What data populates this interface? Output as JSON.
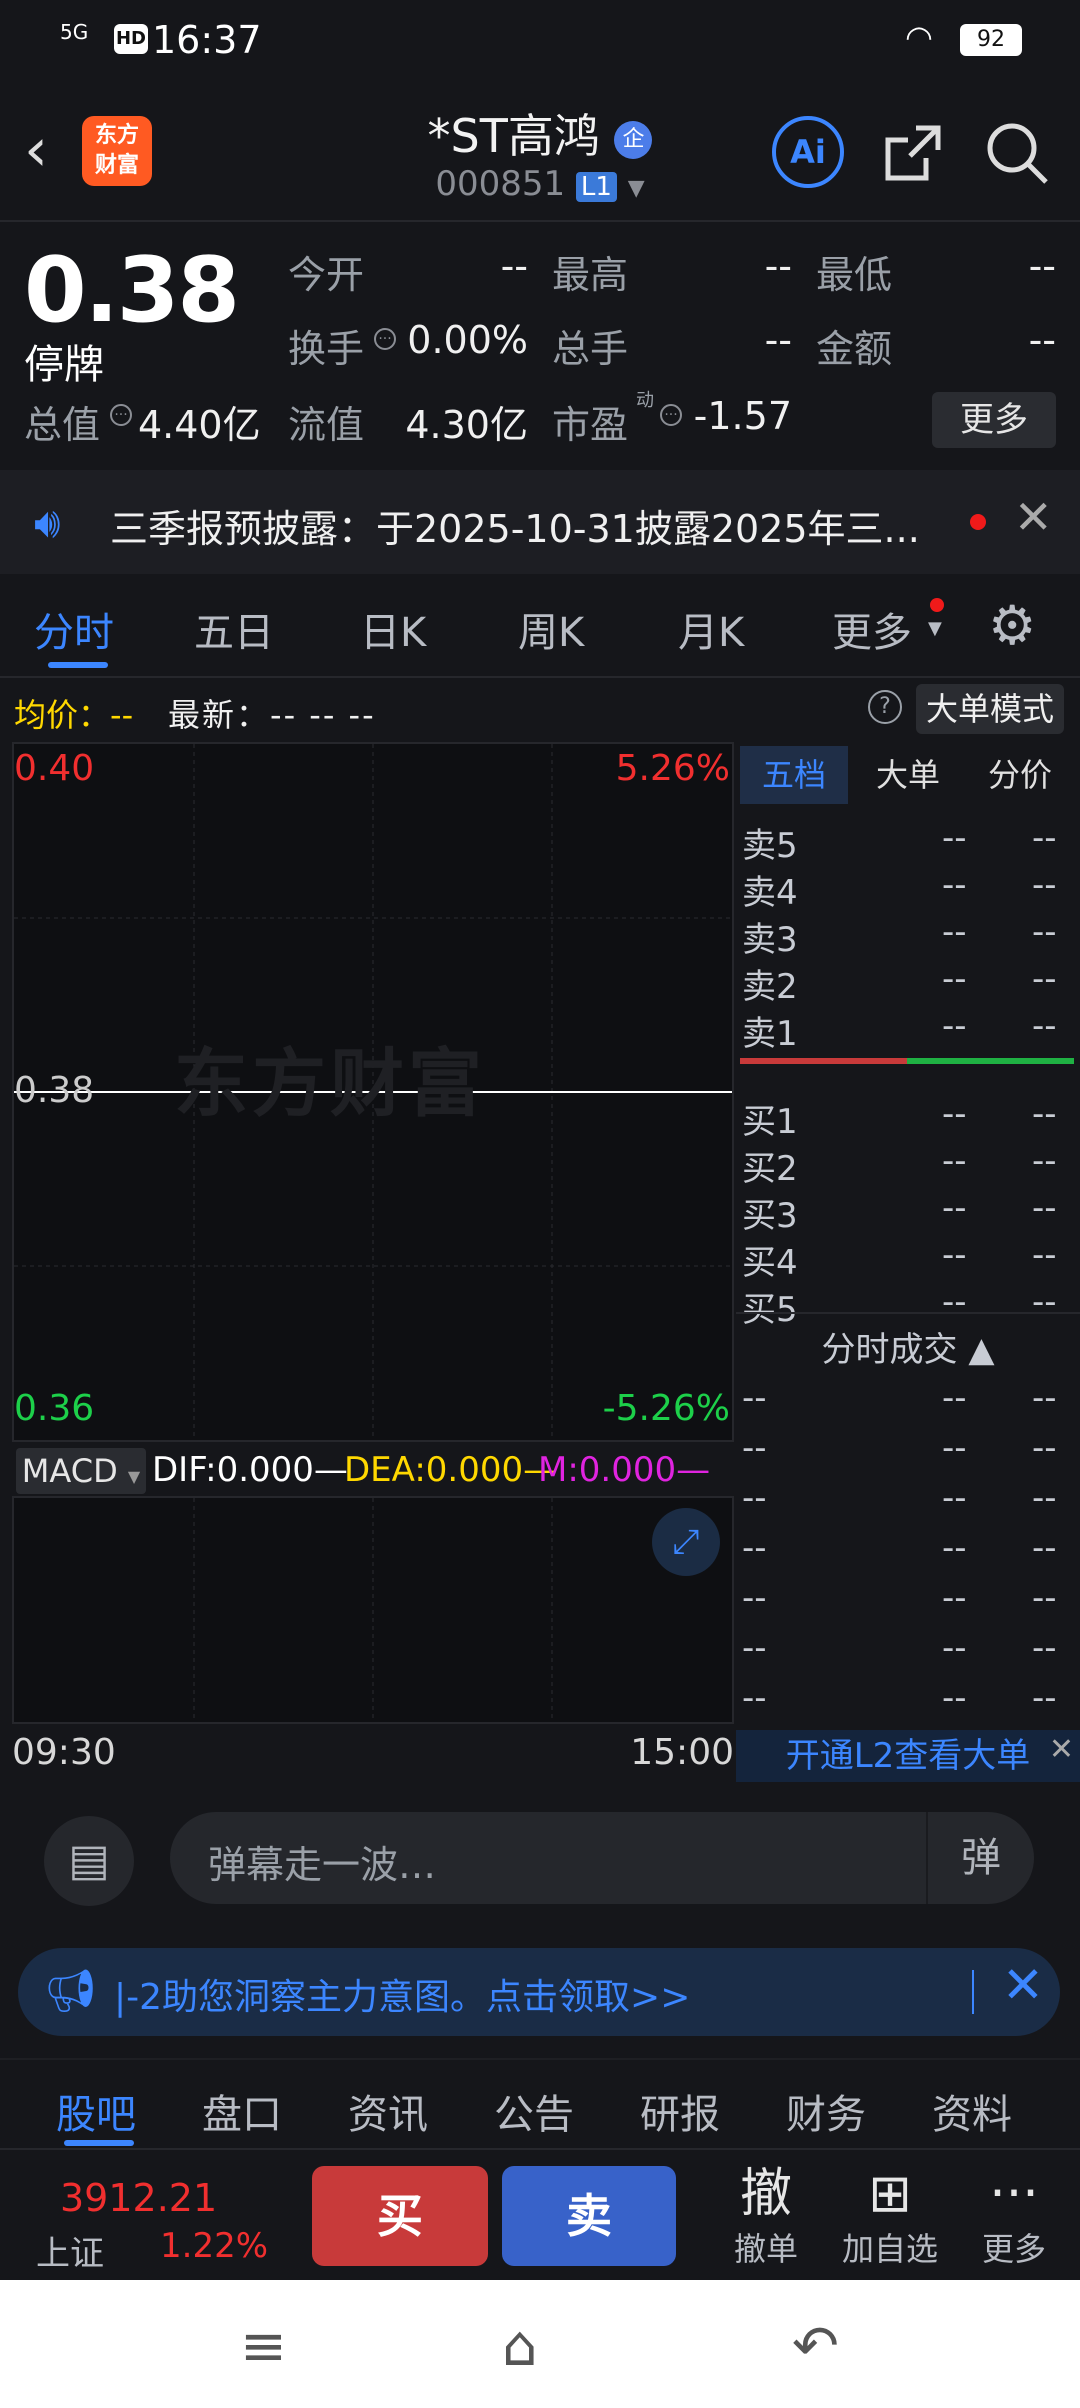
{
  "status": {
    "time": "16:37",
    "network": "5G",
    "hd": "HD",
    "battery": "92"
  },
  "header": {
    "back": "‹",
    "logo_text": "东方\n财富",
    "title": "*ST高鸿",
    "title_badge": "企",
    "code": "000851",
    "level": "L1",
    "ai_label": "Ai"
  },
  "quote": {
    "price": "0.38",
    "status": "停牌",
    "fields": {
      "open_label": "今开",
      "open_val": "--",
      "high_label": "最高",
      "high_val": "--",
      "low_label": "最低",
      "low_val": "--",
      "turnover_label": "换手",
      "turnover_val": "0.00%",
      "volume_label": "总手",
      "volume_val": "--",
      "amount_label": "金额",
      "amount_val": "--",
      "mktcap_label": "总值",
      "mktcap_val": "4.40亿",
      "float_label": "流值",
      "float_val": "4.30亿",
      "pe_label": "市盈",
      "pe_sup": "动",
      "pe_val": "-1.57"
    },
    "more_button": "更多"
  },
  "notice": {
    "text": "三季报预披露：于2025-10-31披露2025年三..."
  },
  "chart_tabs": [
    "分时",
    "五日",
    "日K",
    "周K",
    "月K",
    "更多"
  ],
  "info_row": {
    "avg_label": "均价：",
    "avg_val": "--",
    "latest_label": "最新：",
    "latest_val": "--  --  --",
    "mode_button": "大单模式"
  },
  "chart": {
    "watermark": "东方财富",
    "y_top": "0.40",
    "y_top_pct": "5.26%",
    "y_mid": "0.38",
    "y_bot": "0.36",
    "y_bot_pct": "-5.26%",
    "time_start": "09:30",
    "time_end": "15:00"
  },
  "macd": {
    "select": "MACD",
    "dif": "DIF:0.000—",
    "dea": "DEA:0.000—",
    "m": "M:0.000—"
  },
  "book": {
    "tabs": [
      "五档",
      "大单",
      "分价"
    ],
    "asks": [
      {
        "label": "卖5",
        "price": "--",
        "vol": "--"
      },
      {
        "label": "卖4",
        "price": "--",
        "vol": "--"
      },
      {
        "label": "卖3",
        "price": "--",
        "vol": "--"
      },
      {
        "label": "卖2",
        "price": "--",
        "vol": "--"
      },
      {
        "label": "卖1",
        "price": "--",
        "vol": "--"
      }
    ],
    "bids": [
      {
        "label": "买1",
        "price": "--",
        "vol": "--"
      },
      {
        "label": "买2",
        "price": "--",
        "vol": "--"
      },
      {
        "label": "买3",
        "price": "--",
        "vol": "--"
      },
      {
        "label": "买4",
        "price": "--",
        "vol": "--"
      },
      {
        "label": "买5",
        "price": "--",
        "vol": "--"
      }
    ],
    "ticks_header": "分时成交 ▲",
    "ticks": [
      {
        "t": "--",
        "p": "--",
        "v": "--"
      },
      {
        "t": "--",
        "p": "--",
        "v": "--"
      },
      {
        "t": "--",
        "p": "--",
        "v": "--"
      },
      {
        "t": "--",
        "p": "--",
        "v": "--"
      },
      {
        "t": "--",
        "p": "--",
        "v": "--"
      },
      {
        "t": "--",
        "p": "--",
        "v": "--"
      },
      {
        "t": "--",
        "p": "--",
        "v": "--"
      }
    ],
    "l2_button": "开通L2查看大单"
  },
  "danmu": {
    "placeholder": "弹幕走一波…",
    "switch": "弹"
  },
  "promo": {
    "text": "|-2助您洞察主力意图。点击领取>>"
  },
  "bottom_tabs": [
    "股吧",
    "盘口",
    "资讯",
    "公告",
    "研报",
    "财务",
    "资料"
  ],
  "action_bar": {
    "index_value": "3912.21",
    "index_name": "上证",
    "index_pct": "1.22%",
    "buy": "买",
    "sell": "卖",
    "cancel_icon": "撤",
    "cancel_label": "撤单",
    "add_label": "加自选",
    "more_label": "更多"
  },
  "colors": {
    "up": "#f12f2f",
    "down": "#1dd04a",
    "accent": "#3c86ff",
    "bg": "#15161a"
  }
}
